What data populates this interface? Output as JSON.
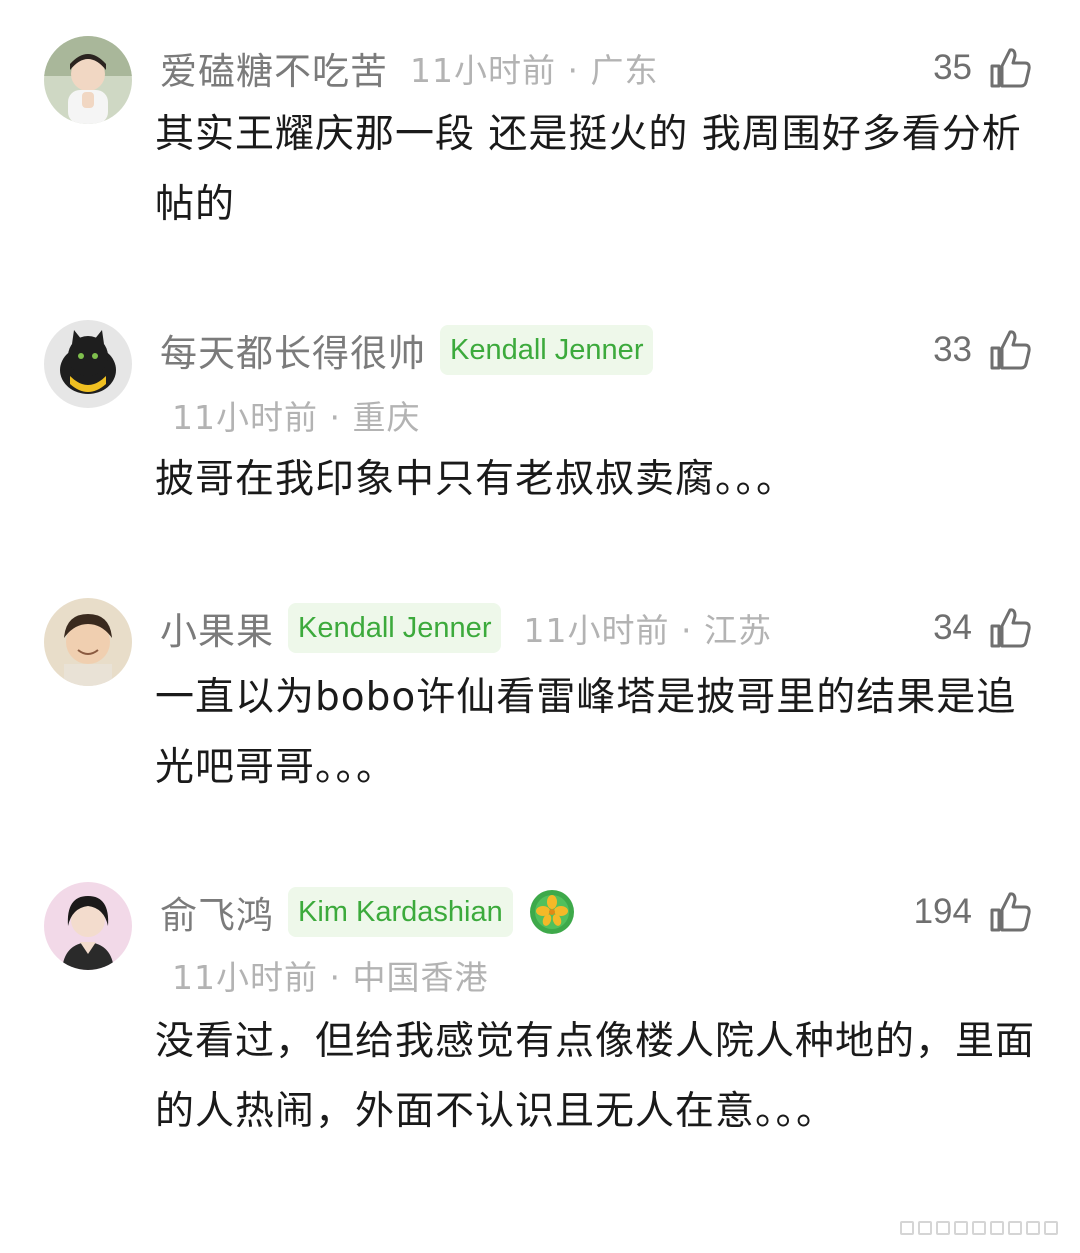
{
  "comments": [
    {
      "username": "爱磕糖不吃苦",
      "badge": "",
      "time_location": "11小时前 · 广东",
      "likes": "35",
      "content": "其实王耀庆那一段 还是挺火的 我周围好多看分析帖的"
    },
    {
      "username": "每天都长得很帅",
      "badge": "Kendall Jenner",
      "time_location": "11小时前 · 重庆",
      "likes": "33",
      "content": "披哥在我印象中只有老叔叔卖腐。。。"
    },
    {
      "username": "小果果",
      "badge": "Kendall Jenner",
      "time_location": "11小时前 · 江苏",
      "likes": "34",
      "content": "一直以为bobo许仙看雷峰塔是披哥里的结果是追光吧哥哥。。。"
    },
    {
      "username": "俞飞鸿",
      "badge": "Kim Kardashian",
      "time_location": "11小时前 · 中国香港",
      "likes": "194",
      "content": "没看过，但给我感觉有点像楼人院人种地的，里面的人热闹，外面不认识且无人在意。。。"
    }
  ],
  "colors": {
    "username": "#7b7b7b",
    "badge_bg": "#eef8ea",
    "badge_text": "#3caa3c",
    "meta": "#b3b3b3",
    "like": "#6f6f6f"
  },
  "icons": {
    "like": "thumbs-up-icon",
    "gem": "gold-flower-badge-icon"
  }
}
